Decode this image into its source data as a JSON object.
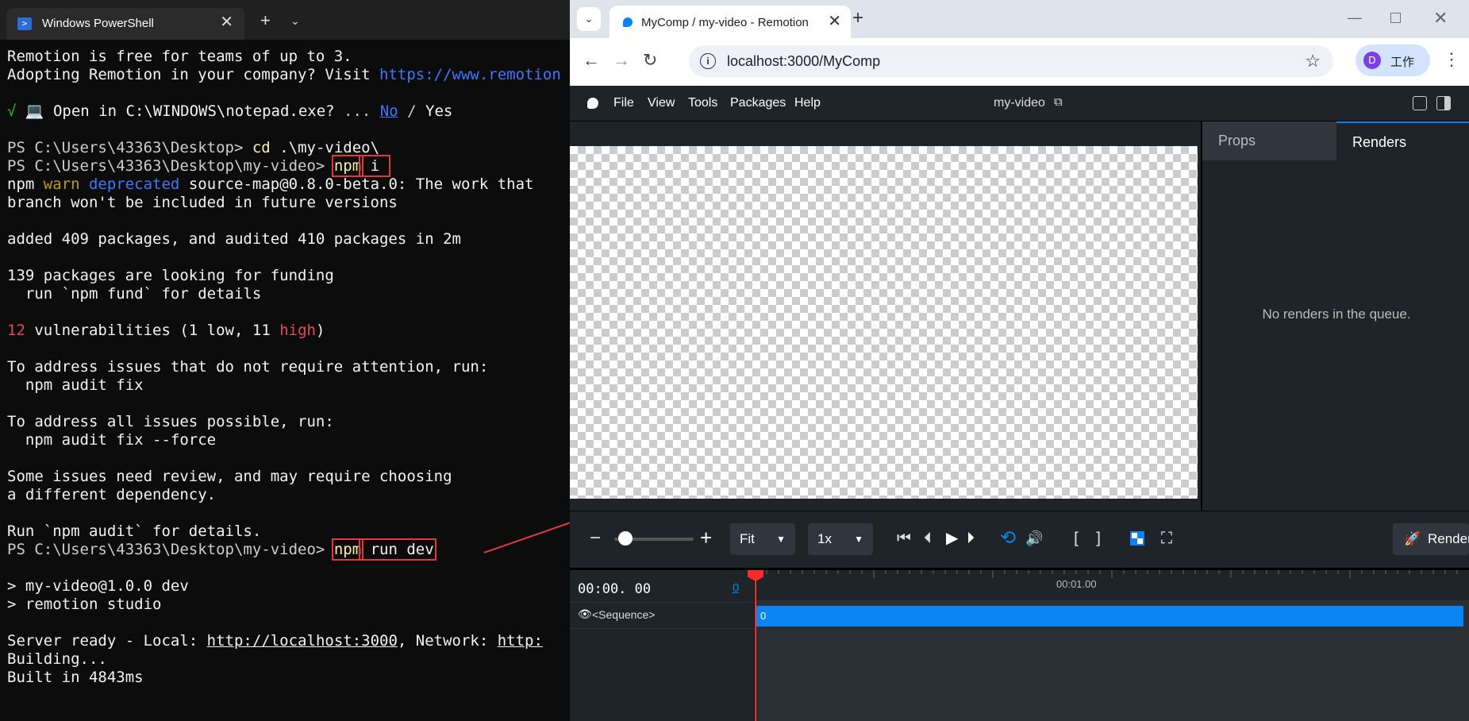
{
  "powershell": {
    "tab_title": "Windows PowerShell",
    "tab_close": "✕",
    "new_tab": "+",
    "dropdown": "⌄",
    "lines": [
      {
        "segs": [
          {
            "t": "Remotion is free for teams of up to 3.",
            "c": "w"
          }
        ]
      },
      {
        "segs": [
          {
            "t": "Adopting Remotion in your company? Visit ",
            "c": "w"
          },
          {
            "t": "https://www.remotion",
            "c": "lnk"
          }
        ]
      },
      {
        "segs": [
          {
            "t": "",
            "c": ""
          }
        ]
      },
      {
        "segs": [
          {
            "t": "√ ",
            "c": "gr"
          },
          {
            "t": "💻 Open in C:\\WINDOWS\\notepad.exe? ",
            "c": "w"
          },
          {
            "t": "... ",
            "c": ""
          },
          {
            "t": "No",
            "c": "bl ul"
          },
          {
            "t": " / ",
            "c": ""
          },
          {
            "t": "Yes",
            "c": "w"
          }
        ]
      },
      {
        "segs": [
          {
            "t": "",
            "c": ""
          }
        ]
      },
      {
        "segs": [
          {
            "t": "PS C:\\Users\\43363\\Desktop> ",
            "c": ""
          },
          {
            "t": "cd",
            "c": "y"
          },
          {
            "t": " .\\my-video\\",
            "c": "w"
          }
        ]
      },
      {
        "segs": [
          {
            "t": "PS C:\\Users\\43363\\Desktop\\my-video> ",
            "c": ""
          },
          {
            "t": "npm",
            "c": "y boxed"
          },
          {
            "t": " i ",
            "c": "w boxed"
          }
        ]
      },
      {
        "segs": [
          {
            "t": "npm ",
            "c": "w"
          },
          {
            "t": "warn",
            "c": "warn"
          },
          {
            "t": " ",
            "c": ""
          },
          {
            "t": "deprecated",
            "c": "bl"
          },
          {
            "t": " source-map@0.8.0-beta.0: The work that",
            "c": "w"
          }
        ]
      },
      {
        "segs": [
          {
            "t": "branch won't be included in future versions",
            "c": "w"
          }
        ]
      },
      {
        "segs": [
          {
            "t": "",
            "c": ""
          }
        ]
      },
      {
        "segs": [
          {
            "t": "added 409 packages, and audited 410 packages in 2m",
            "c": "w"
          }
        ]
      },
      {
        "segs": [
          {
            "t": "",
            "c": ""
          }
        ]
      },
      {
        "segs": [
          {
            "t": "139 packages are looking for funding",
            "c": "w"
          }
        ]
      },
      {
        "segs": [
          {
            "t": "  run `npm fund` for details",
            "c": "w"
          }
        ]
      },
      {
        "segs": [
          {
            "t": "",
            "c": ""
          }
        ]
      },
      {
        "segs": [
          {
            "t": "12",
            "c": "red"
          },
          {
            "t": " vulnerabilities (1 ",
            "c": "w"
          },
          {
            "t": "low",
            "c": "w"
          },
          {
            "t": ", 11 ",
            "c": "w"
          },
          {
            "t": "high",
            "c": "red"
          },
          {
            "t": ")",
            "c": "w"
          }
        ]
      },
      {
        "segs": [
          {
            "t": "",
            "c": ""
          }
        ]
      },
      {
        "segs": [
          {
            "t": "To address issues that do not require attention, run:",
            "c": "w"
          }
        ]
      },
      {
        "segs": [
          {
            "t": "  npm audit fix",
            "c": "w"
          }
        ]
      },
      {
        "segs": [
          {
            "t": "",
            "c": ""
          }
        ]
      },
      {
        "segs": [
          {
            "t": "To address all issues possible, run:",
            "c": "w"
          }
        ]
      },
      {
        "segs": [
          {
            "t": "  npm audit fix --force",
            "c": "w"
          }
        ]
      },
      {
        "segs": [
          {
            "t": "",
            "c": ""
          }
        ]
      },
      {
        "segs": [
          {
            "t": "Some issues need review, and may require choosing",
            "c": "w"
          }
        ]
      },
      {
        "segs": [
          {
            "t": "a different dependency.",
            "c": "w"
          }
        ]
      },
      {
        "segs": [
          {
            "t": "",
            "c": ""
          }
        ]
      },
      {
        "segs": [
          {
            "t": "Run `npm audit` for details.",
            "c": "w"
          }
        ]
      },
      {
        "segs": [
          {
            "t": "PS C:\\Users\\43363\\Desktop\\my-video> ",
            "c": ""
          },
          {
            "t": "npm",
            "c": "y boxed"
          },
          {
            "t": " run dev",
            "c": "w boxed"
          }
        ]
      },
      {
        "segs": [
          {
            "t": "",
            "c": ""
          }
        ]
      },
      {
        "segs": [
          {
            "t": "> my-video@1.0.0 dev",
            "c": "w"
          }
        ]
      },
      {
        "segs": [
          {
            "t": "> remotion studio",
            "c": "w"
          }
        ]
      },
      {
        "segs": [
          {
            "t": "",
            "c": ""
          }
        ]
      },
      {
        "segs": [
          {
            "t": "Server ready - Local: ",
            "c": "w"
          },
          {
            "t": "http://localhost:3000",
            "c": "w ul"
          },
          {
            "t": ", Network: ",
            "c": "w"
          },
          {
            "t": "http:",
            "c": "w ul"
          }
        ]
      },
      {
        "segs": [
          {
            "t": "Building...",
            "c": "w"
          }
        ]
      },
      {
        "segs": [
          {
            "t": "Built in 4843ms",
            "c": "w"
          }
        ]
      }
    ]
  },
  "chrome": {
    "tab_search": "⌄",
    "tab_title": "MyComp / my-video - Remotion",
    "tab_close": "✕",
    "new_tab": "+",
    "window_min": "—",
    "window_close": "✕",
    "back": "←",
    "forward": "→",
    "reload": "↻",
    "url": "localhost:3000/MyComp",
    "star": "☆",
    "profile_initial": "D",
    "profile_label": "工作",
    "menu": "⋮"
  },
  "remotion": {
    "menu": [
      "File",
      "View",
      "Tools",
      "Packages",
      "Help"
    ],
    "project_name": "my-video",
    "ext_link": "⧉",
    "panel_tabs": {
      "props": "Props",
      "renders": "Renders"
    },
    "no_renders": "No renders in the queue.",
    "zoom_minus": "−",
    "zoom_plus": "+",
    "zoom_level": 0.05,
    "fit_select": "Fit",
    "speed_select": "1x",
    "caret": "▼",
    "controls": {
      "jump_start": "⏮",
      "step_back": "⏴",
      "play": "▶",
      "step_forward": "⏵",
      "loop": "⟲",
      "volume": "🔊",
      "in_mark": "[",
      "out_mark": "]",
      "fullscreen": "⛶"
    },
    "render_icon": "🚀",
    "render_label": "Render",
    "timecode": "00:00. 00",
    "frame": "0",
    "eye": "👁",
    "sequence_label": "<Sequence>",
    "ruler_label": "00:01.00",
    "sequence_bar_label": "0"
  }
}
